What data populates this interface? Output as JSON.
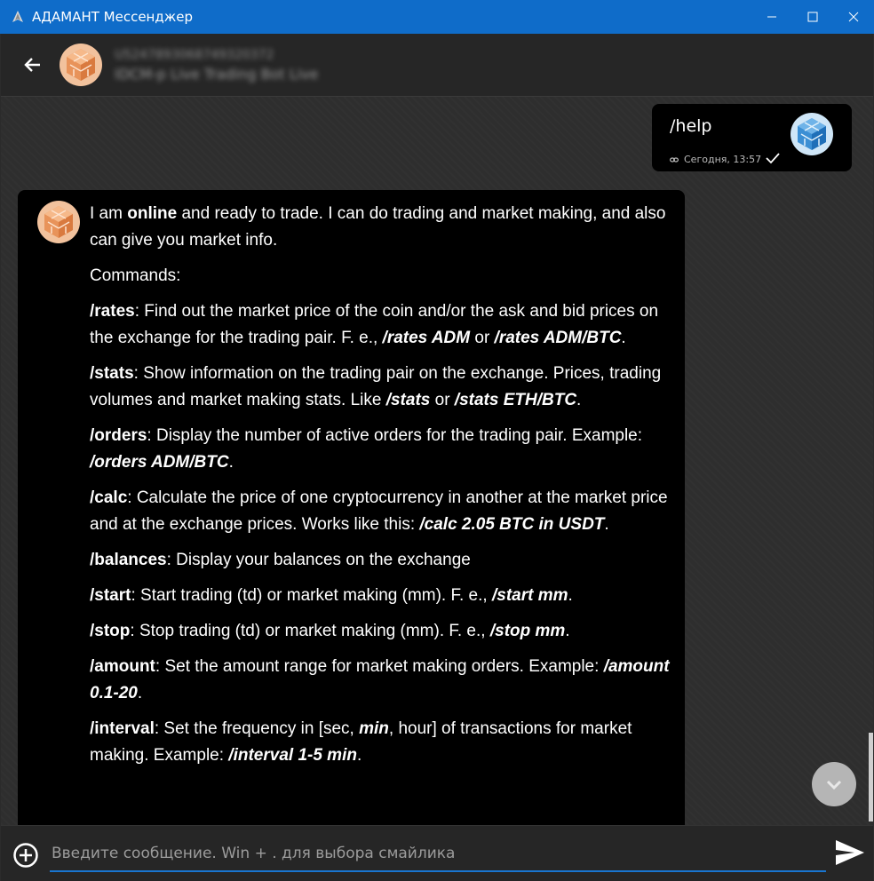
{
  "window": {
    "title": "АДАМАНТ Мессенджер",
    "controls": {
      "minimize": "minimize",
      "maximize": "maximize",
      "close": "close"
    }
  },
  "header": {
    "address": "U5247893068749320372",
    "name": "IDCM-p Live Trading Bot Live"
  },
  "messages": {
    "outgoing": {
      "text": "/help",
      "timestamp": "Сегодня, 13:57"
    },
    "incoming": {
      "p1": {
        "a": "I am ",
        "b": "online",
        "c": " and ready to trade. I can do trading and market making, and also can give you market info."
      },
      "p2": "Commands:",
      "rates": {
        "cmd": "/rates",
        "text": ": Find out the market price of the coin and/or the ask and bid prices on the exchange for the trading pair. F. e., ",
        "ex1": "/rates ADM",
        "mid": " or ",
        "ex2": "/rates ADM/BTC",
        "end": "."
      },
      "stats": {
        "cmd": "/stats",
        "text": ": Show information on the trading pair on the exchange. Prices, trading volumes and market making stats. Like ",
        "ex1": "/stats",
        "mid": " or ",
        "ex2": "/stats ETH/BTC",
        "end": "."
      },
      "orders": {
        "cmd": "/orders",
        "text": ": Display the number of active orders for the trading pair. Example: ",
        "ex1": "/orders ADM/BTC",
        "end": "."
      },
      "calc": {
        "cmd": "/calc",
        "text": ": Calculate the price of one cryptocurrency in another at the market price and at the exchange prices. Works like this: ",
        "ex1": "/calc 2.05 BTC in USDT",
        "end": "."
      },
      "balances": {
        "cmd": "/balances",
        "text": ": Display your balances on the exchange"
      },
      "start": {
        "cmd": "/start",
        "text": ": Start trading (td) or market making (mm). F. e., ",
        "ex1": "/start mm",
        "end": "."
      },
      "stop": {
        "cmd": "/stop",
        "text": ": Stop trading (td) or market making (mm). F. e., ",
        "ex1": "/stop mm",
        "end": "."
      },
      "amount": {
        "cmd": "/amount",
        "text": ": Set the amount range for market making orders. Example: ",
        "ex1": "/amount 0.1-20",
        "end": "."
      },
      "interval": {
        "cmd": "/interval",
        "text": ": Set the frequency in [sec, ",
        "mid_b": "min",
        "text2": ", hour] of transactions for market making. Example: ",
        "ex1": "/interval 1-5 min",
        "end": "."
      }
    }
  },
  "input": {
    "placeholder": "Введите сообщение. Win + . для выбора смайлика"
  },
  "colors": {
    "titlebar": "#0f6cc9",
    "bubble": "#000000",
    "accent": "#1976d2",
    "bot_avatar": "#e8a270",
    "user_avatar": "#3b8fd4"
  },
  "icons": {
    "app": "adamant-icon",
    "back": "arrow-left-icon",
    "add": "plus-circle-icon",
    "send": "send-icon",
    "scroll": "chevron-down-icon",
    "status": "check-icon",
    "link": "link-icon"
  }
}
